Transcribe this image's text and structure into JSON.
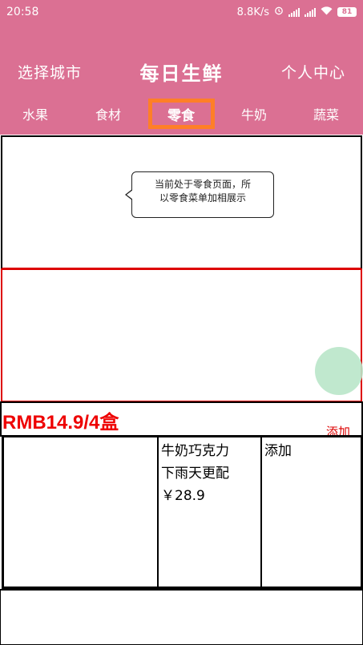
{
  "status_bar": {
    "time": "20:58",
    "network_speed": "8.8K/s",
    "battery": "81",
    "icons": [
      "alarm-icon",
      "signal-icon",
      "signal-icon",
      "wifi-icon",
      "battery-icon"
    ]
  },
  "header": {
    "left_label": "选择城市",
    "title": "每日生鲜",
    "right_label": "个人中心",
    "background_color": "#db7093"
  },
  "tabs": [
    {
      "label": "水果",
      "active": false
    },
    {
      "label": "食材",
      "active": false
    },
    {
      "label": "零食",
      "active": true
    },
    {
      "label": "牛奶",
      "active": false
    },
    {
      "label": "蔬菜",
      "active": false
    }
  ],
  "tooltip": {
    "line1": "当前处于零食页面，所",
    "line2": "以零食菜单加相展示"
  },
  "price_row": {
    "price": "RMB14.9/4盒",
    "add_label": "添加"
  },
  "product": {
    "name_line1": "牛奶巧克力",
    "name_line2": "下雨天更配",
    "price": "￥28.9",
    "add_label": "添加"
  },
  "colors": {
    "accent": "#db7093",
    "active_tab_border": "#ff7f27",
    "price": "#e00000",
    "fab": "#b9e5c9"
  }
}
